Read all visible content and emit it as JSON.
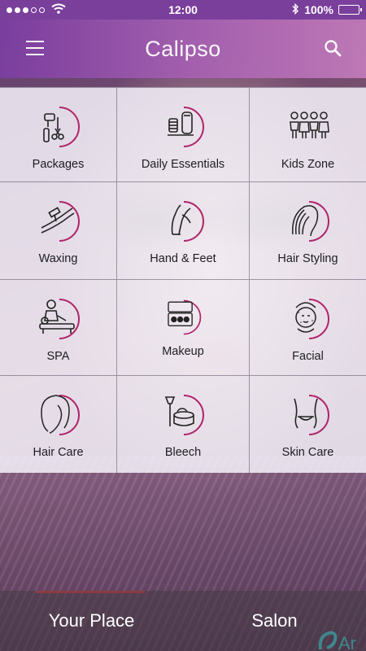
{
  "status_bar": {
    "time": "12:00",
    "battery": "100%",
    "battery_level": 1.0,
    "signal_dots_filled": 3,
    "signal_dots_total": 5
  },
  "header": {
    "title": "Calipso",
    "menu_icon": "hamburger-menu-icon",
    "search_icon": "search-icon"
  },
  "categories": [
    {
      "label": "Packages",
      "icon": "hair-tools-icon"
    },
    {
      "label": "Daily Essentials",
      "icon": "trimmer-icon"
    },
    {
      "label": "Kids Zone",
      "icon": "kids-icon"
    },
    {
      "label": "Waxing",
      "icon": "waxing-leg-icon"
    },
    {
      "label": "Hand & Feet",
      "icon": "hand-feet-icon"
    },
    {
      "label": "Hair Styling",
      "icon": "hair-styling-icon"
    },
    {
      "label": "SPA",
      "icon": "spa-massage-icon"
    },
    {
      "label": "Makeup",
      "icon": "makeup-palette-icon"
    },
    {
      "label": "Facial",
      "icon": "facial-mask-icon"
    },
    {
      "label": "Hair Care",
      "icon": "hair-care-icon"
    },
    {
      "label": "Bleech",
      "icon": "bleach-brush-icon"
    },
    {
      "label": "Skin Care",
      "icon": "skin-care-body-icon"
    }
  ],
  "tabs": {
    "your_place": "Your Place",
    "salon": "Salon",
    "active": "your_place"
  },
  "colors": {
    "header_start": "#7b3ea0",
    "header_end": "#c07ab8",
    "icon_accent": "#b0246a",
    "tab_indicator": "#e23a3a"
  }
}
